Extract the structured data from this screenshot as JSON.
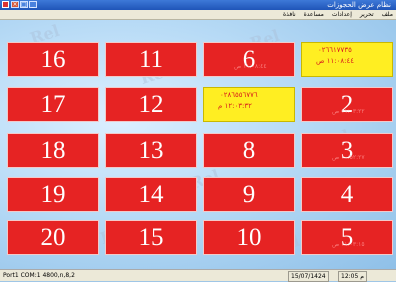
{
  "window": {
    "title": "نظام عرض الحجوزات"
  },
  "menu": [
    "ملف",
    "تحرير",
    "إعدادات",
    "مساعدة",
    "نافذة"
  ],
  "watermark": "Rel",
  "tiles": [
    {
      "number": "16",
      "color": "red"
    },
    {
      "number": "11",
      "color": "red"
    },
    {
      "number": "6",
      "color": "red",
      "ghost": "١١:٠٨:٤٤ ص"
    },
    {
      "number": "",
      "color": "yellow",
      "line1": "٠٢٦٦١٧٧٣٥",
      "line2": "١١:٠٨:٤٤ ص"
    },
    {
      "number": "17",
      "color": "red"
    },
    {
      "number": "12",
      "color": "red"
    },
    {
      "number": "",
      "color": "yellow",
      "line1": "٠٢٨٦٥٥٦٧٧٦",
      "line2": "١٢:٠٣:٣٢ م"
    },
    {
      "number": "2",
      "color": "red",
      "ghost": "١١:٠٣:٢٢ ص"
    },
    {
      "number": "18",
      "color": "red"
    },
    {
      "number": "13",
      "color": "red"
    },
    {
      "number": "8",
      "color": "red"
    },
    {
      "number": "3",
      "color": "red",
      "ghost": "١٠:٥٢:٢٧ ص"
    },
    {
      "number": "19",
      "color": "red"
    },
    {
      "number": "14",
      "color": "red"
    },
    {
      "number": "9",
      "color": "red"
    },
    {
      "number": "4",
      "color": "red"
    },
    {
      "number": "20",
      "color": "red"
    },
    {
      "number": "15",
      "color": "red"
    },
    {
      "number": "10",
      "color": "red"
    },
    {
      "number": "5",
      "color": "red",
      "ghost": "١١:٠٣:١٥ ص"
    }
  ],
  "status": {
    "port": "Port1 COM:1 4800,n,8,2",
    "date": "15/07/1424",
    "time": "12:05 م"
  },
  "colors": {
    "tile_red": "#e62323",
    "tile_yellow": "#ffee22",
    "titlebar": "#2a62c9"
  }
}
